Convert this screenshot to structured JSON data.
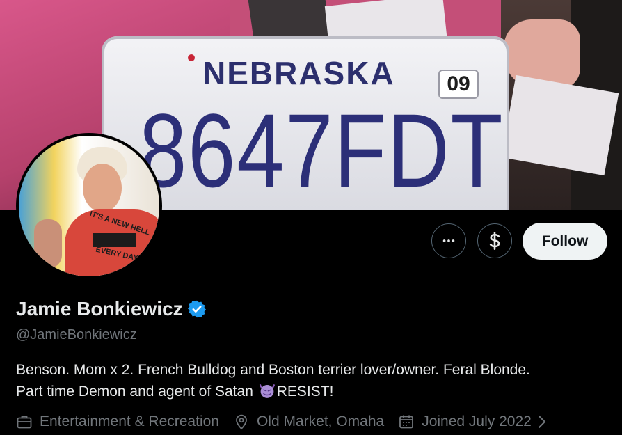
{
  "banner": {
    "plate_state": "NEBRASKA",
    "plate_year": "09",
    "plate_number": "8647FDT"
  },
  "avatar": {
    "shirt_text_top": "IT'S A NEW HELL",
    "shirt_text_bottom": "EVERY DAY"
  },
  "actions": {
    "more_icon": "more-horizontal-icon",
    "subscribe_icon": "dollar-sign-icon",
    "follow_label": "Follow"
  },
  "profile": {
    "display_name": "Jamie Bonkiewicz",
    "verified_icon": "verified-badge-icon",
    "handle": "@JamieBonkiewicz",
    "bio_part1": "Benson. Mom x 2. French Bulldog and Boston terrier lover/owner. Feral Blonde.",
    "bio_part2": "Part time Demon and agent of Satan ",
    "bio_emoji": "smiling-devil-emoji",
    "bio_part3": "RESIST!"
  },
  "meta": {
    "category_icon": "briefcase-icon",
    "category": "Entertainment & Recreation",
    "location_icon": "location-pin-icon",
    "location": "Old Market, Omaha",
    "joined_icon": "calendar-icon",
    "joined": "Joined July 2022",
    "more_icon": "chevron-right-icon"
  },
  "colors": {
    "background": "#000000",
    "text_primary": "#e7e9ea",
    "text_secondary": "#71767b",
    "verified_blue": "#1d9bf0",
    "follow_bg": "#eff3f4",
    "border": "#536471"
  }
}
